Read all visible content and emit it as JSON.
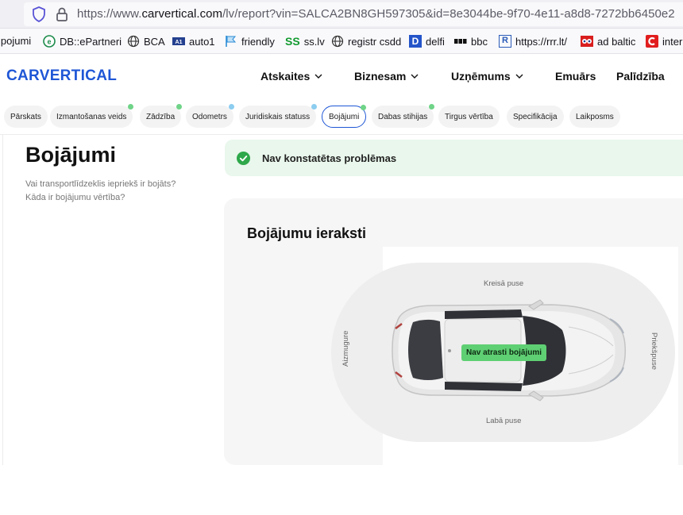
{
  "browser": {
    "url_prefix": "https://www.",
    "url_domain": "carvertical.com",
    "url_path": "/lv/report?vin=SALCA2BN8GH597305&id=8e3044be-9f70-4e11-a8d8-7272bb6450e2"
  },
  "bookmarks": [
    {
      "label": "lpojumi",
      "icon": "none"
    },
    {
      "label": "DB::ePartneri",
      "icon": "db-icon"
    },
    {
      "label": "BCA",
      "icon": "globe-icon"
    },
    {
      "label": "auto1",
      "icon": "auto1-icon"
    },
    {
      "label": "friendly",
      "icon": "flag-icon"
    },
    {
      "label": "ss.lv",
      "icon": "ss-icon",
      "icon_text": "SS"
    },
    {
      "label": "registr csdd",
      "icon": "globe-icon"
    },
    {
      "label": "delfi",
      "icon": "delfi-icon",
      "icon_text": "D"
    },
    {
      "label": "bbc",
      "icon": "bbc-icon"
    },
    {
      "label": "https://rrr.lt/",
      "icon": "rrr-icon",
      "icon_text": "R"
    },
    {
      "label": "ad baltic",
      "icon": "adbaltic-icon"
    },
    {
      "label": "inter",
      "icon": "inter-icon"
    }
  ],
  "header": {
    "logo": "CARVERTICAL",
    "nav": [
      {
        "label": "Atskaites",
        "dropdown": true
      },
      {
        "label": "Biznesam",
        "dropdown": true
      },
      {
        "label": "Uzņēmums",
        "dropdown": true
      },
      {
        "label": "Emuārs",
        "dropdown": false
      },
      {
        "label": "Palīdzība",
        "dropdown": false
      }
    ]
  },
  "tabs": [
    {
      "label": "Pārskats",
      "dot": ""
    },
    {
      "label": "Izmantošanas veids",
      "dot": "#6fd488"
    },
    {
      "label": "Zādzība",
      "dot": "#6fd488"
    },
    {
      "label": "Odometrs",
      "dot": "#8ccdf0"
    },
    {
      "label": "Juridiskais statuss",
      "dot": "#8ccdf0"
    },
    {
      "label": "Bojājumi",
      "dot": "#6fd488",
      "active": true
    },
    {
      "label": "Dabas stihijas",
      "dot": "#6fd488"
    },
    {
      "label": "Tirgus vērtība",
      "dot": ""
    },
    {
      "label": "Specifikācija",
      "dot": ""
    },
    {
      "label": "Laikposms",
      "dot": ""
    }
  ],
  "section": {
    "title": "Bojājumi",
    "questions": [
      "Vai transportlīdzeklis iepriekš ir bojāts?",
      "Kāda ir bojājumu vērtība?"
    ]
  },
  "status": {
    "text": "Nav konstatētas problēmas",
    "color": "#5fcf73"
  },
  "damage": {
    "title": "Bojājumu ieraksti",
    "left_side": "Kreisā puse",
    "right_side": "Labā puse",
    "rear": "Aizmugure",
    "front": "Priekšpuse",
    "badge": "Nav atrasti bojājumi"
  },
  "colors": {
    "brand": "#1e56d6",
    "success": "#5fcf73"
  }
}
